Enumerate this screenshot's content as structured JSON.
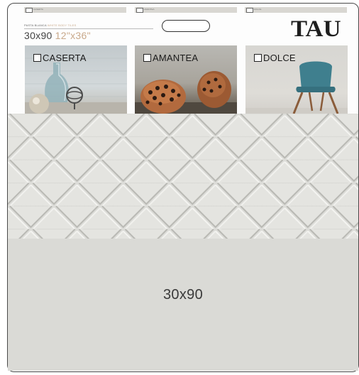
{
  "swatches": [
    {
      "label": "CASERTA"
    },
    {
      "label": "AMANTEA"
    },
    {
      "label": "DOLCE"
    }
  ],
  "header": {
    "body_type_es": "PASTA BLANCA",
    "body_type_en": "WHITE BODY TILES",
    "size_metric": "30x90",
    "size_imperial": "12\"x36\"",
    "brand": "TAU"
  },
  "collections": [
    {
      "name": "CASERTA"
    },
    {
      "name": "AMANTEA"
    },
    {
      "name": "DOLCE"
    }
  ],
  "sample": {
    "size_label": "30x90"
  },
  "colors": {
    "tile_surface": "#dadad6",
    "imperial_accent": "#c9a98b",
    "dolce_chair": "#3f7f8e"
  }
}
